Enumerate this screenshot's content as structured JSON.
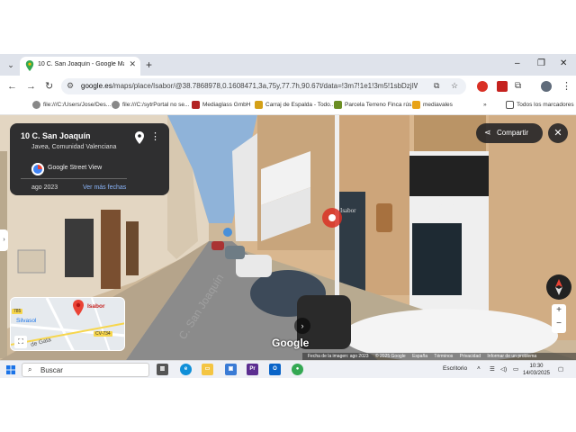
{
  "browser": {
    "tab": {
      "title": "10 C. San Joaquín - Google Maps"
    },
    "omnibox": {
      "domain": "google.es",
      "path": "/maps/place/Isabor/@38.7868978,0.1608471,3a,75y,77.7h,90.67t/data=!3m7!1e1!3m5!1sbDzjIWD..."
    },
    "bookmarks": [
      {
        "label": "file:///C:/Users/Jose/Des...",
        "color": "#888888"
      },
      {
        "label": "file:///C:/sytrPortal no se...",
        "color": "#888888"
      },
      {
        "label": "Mediaglass GmbH",
        "color": "#b22222"
      },
      {
        "label": "Carraj de Espalda - Todo...",
        "color": "#d4a017"
      },
      {
        "label": "Parcela Terreno Finca rús...",
        "color": "#6b8e23"
      },
      {
        "label": "mediavales",
        "color": "#e8a317"
      }
    ],
    "all_bookmarks": "Todos los marcadores"
  },
  "streetview": {
    "info": {
      "title": "10 C. San Joaquín",
      "subtitle": "Javea, Comunidad Valenciana",
      "brand": "Google Street View",
      "date": "ago 2023",
      "more_dates": "Ver más fechas"
    },
    "share_label": "Compartir",
    "minimap": {
      "place": "Isabor",
      "poi": "Silvasol",
      "road1": "CV-734",
      "road2": "785",
      "street": "de Gata"
    },
    "signage": "Isabor",
    "street_name": "C. San Joaquín",
    "logo": "Google",
    "attribution": [
      "Fecha de la imagen: ago 2023",
      "© 2025 Google",
      "España",
      "Términos",
      "Privacidad",
      "Informar de un problema"
    ]
  },
  "taskbar": {
    "search_label": "Buscar",
    "desktop": "Escritorio",
    "time": "10:30",
    "date": "14/03/2025"
  }
}
